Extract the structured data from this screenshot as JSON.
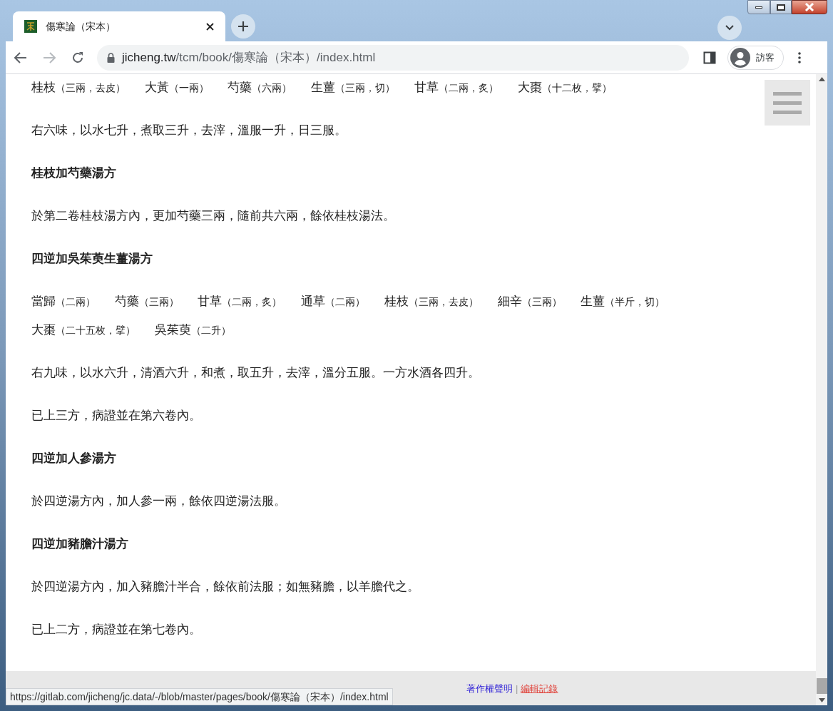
{
  "tab": {
    "title": "傷寒論（宋本）",
    "selected": true
  },
  "address": {
    "host": "jicheng.tw",
    "path": "/tcm/book/傷寒論（宋本）/index.html"
  },
  "profile": {
    "label": "訪客"
  },
  "blocks": [
    {
      "kind": "ingredients",
      "items": [
        {
          "name": "桂枝",
          "note": "（三兩，去皮）"
        },
        {
          "name": "大黃",
          "note": "（一兩）"
        },
        {
          "name": "芍藥",
          "note": "（六兩）"
        },
        {
          "name": "生薑",
          "note": "（三兩，切）"
        },
        {
          "name": "甘草",
          "note": "（二兩，炙）"
        },
        {
          "name": "大棗",
          "note": "（十二枚，擘）"
        }
      ]
    },
    {
      "kind": "text",
      "text": "右六味，以水七升，煮取三升，去滓，溫服一升，日三服。"
    },
    {
      "kind": "heading",
      "text": "桂枝加芍藥湯方"
    },
    {
      "kind": "text",
      "text": "於第二卷桂枝湯方內，更加芍藥三兩，隨前共六兩，餘依桂枝湯法。"
    },
    {
      "kind": "heading",
      "text": "四逆加吳茱萸生薑湯方"
    },
    {
      "kind": "ingredients",
      "items": [
        {
          "name": "當歸",
          "note": "（二兩）"
        },
        {
          "name": "芍藥",
          "note": "（三兩）"
        },
        {
          "name": "甘草",
          "note": "（二兩，炙）"
        },
        {
          "name": "通草",
          "note": "（二兩）"
        },
        {
          "name": "桂枝",
          "note": "（三兩，去皮）"
        },
        {
          "name": "細辛",
          "note": "（三兩）"
        },
        {
          "name": "生薑",
          "note": "（半斤，切）"
        },
        {
          "name": "大棗",
          "note": "（二十五枚，擘）"
        },
        {
          "name": "吳茱萸",
          "note": "（二升）"
        }
      ]
    },
    {
      "kind": "text",
      "text": "右九味，以水六升，清酒六升，和煮，取五升，去滓，溫分五服。一方水酒各四升。"
    },
    {
      "kind": "text",
      "text": "已上三方，病證並在第六卷內。"
    },
    {
      "kind": "heading",
      "text": "四逆加人參湯方"
    },
    {
      "kind": "text",
      "text": "於四逆湯方內，加人參一兩，餘依四逆湯法服。"
    },
    {
      "kind": "heading",
      "text": "四逆加豬膽汁湯方"
    },
    {
      "kind": "text",
      "text": "於四逆湯方內，加入豬膽汁半合，餘依前法服；如無豬膽，以羊膽代之。"
    },
    {
      "kind": "text",
      "text": "已上二方，病證並在第七卷內。"
    }
  ],
  "footer": {
    "items": [
      {
        "kind": "link",
        "label": "著作權聲明",
        "hovered": false
      },
      {
        "kind": "separator",
        "label": "|"
      },
      {
        "kind": "link",
        "label": "編輯記錄",
        "hovered": true
      }
    ]
  },
  "status_url": "https://gitlab.com/jicheng/jc.data/-/blob/master/pages/book/傷寒論（宋本）/index.html"
}
